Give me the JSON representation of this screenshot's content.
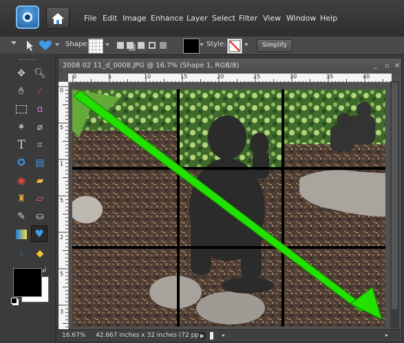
{
  "menubar": {
    "menus": [
      "File",
      "Edit",
      "Image",
      "Enhance",
      "Layer",
      "Select",
      "Filter",
      "View",
      "Window",
      "Help"
    ]
  },
  "options_bar": {
    "shape_label": "Shape:",
    "style_label": "Style:",
    "simplify_label": "Simplify",
    "colors": {
      "swatch": "#000000",
      "style_slash": "#e01b1b"
    }
  },
  "document": {
    "title": "2008 02 11_d_0008.JPG @ 16.7% (Shape 1, RGB/8)",
    "ruler_h_labels": [
      "0",
      "5",
      "10",
      "15",
      "20",
      "25",
      "30",
      "35",
      "40"
    ],
    "ruler_v_labels": [
      "0",
      "5",
      "1",
      "5",
      "2",
      "5",
      "3"
    ],
    "zoom": "16.67%",
    "doc_size": "42.667 inches x 32 inches (72 ppi)"
  },
  "arrow": {
    "color": "#22e000"
  },
  "toolbox": {
    "foreground": "#000000",
    "background": "#ffffff",
    "tools": [
      "move-icon",
      "zoom-icon",
      "hand-icon",
      "eyedropper-icon",
      "marquee-icon",
      "lasso-icon",
      "magic-wand-icon",
      "quick-selection-icon",
      "type-icon",
      "crop-icon",
      "cookie-cutter-icon",
      "recompose-icon",
      "red-eye-icon",
      "healing-brush-icon",
      "clone-stamp-icon",
      "eraser-icon",
      "brush-icon",
      "paint-bucket-icon",
      "gradient-icon",
      "custom-shape-icon",
      "blur-icon",
      "sponge-icon"
    ]
  }
}
